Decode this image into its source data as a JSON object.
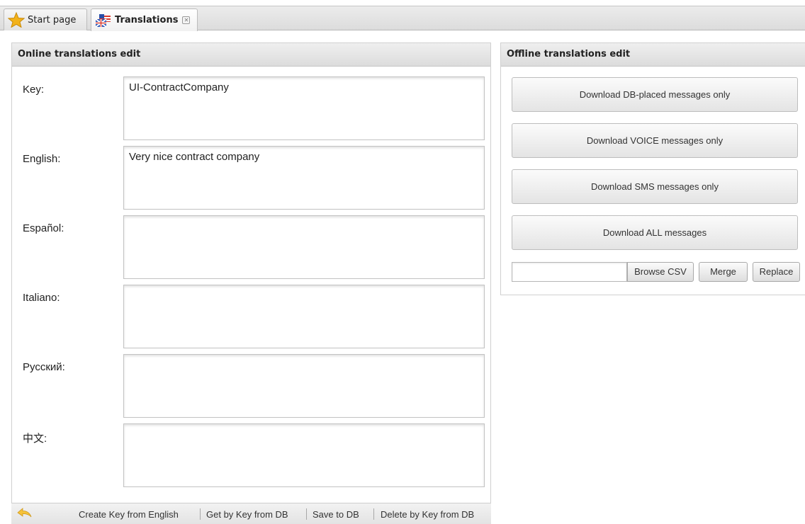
{
  "tabs": [
    {
      "label": "Start page",
      "icon": "star-icon"
    },
    {
      "label": "Translations",
      "icon": "flags-icon",
      "closable": true,
      "active": true
    }
  ],
  "online_panel": {
    "title": "Online translations edit",
    "fields": [
      {
        "label": "Key:",
        "value": "UI-ContractCompany"
      },
      {
        "label": "English:",
        "value": "Very nice contract company"
      },
      {
        "label": "Español:",
        "value": ""
      },
      {
        "label": "Italiano:",
        "value": ""
      },
      {
        "label": "Русский:",
        "value": ""
      },
      {
        "label": "中文:",
        "value": ""
      }
    ]
  },
  "toolbar": {
    "back_icon": "back-arrow-icon",
    "create_key_label": "Create Key from English",
    "get_by_key_label": "Get by Key from DB",
    "save_label": "Save to DB",
    "delete_label": "Delete by Key from DB"
  },
  "offline_panel": {
    "title": "Offline translations edit",
    "download_db_label": "Download DB-placed messages only",
    "download_voice_label": "Download VOICE messages only",
    "download_sms_label": "Download SMS messages only",
    "download_all_label": "Download ALL messages",
    "csv_file_value": "",
    "browse_label": "Browse CSV",
    "merge_label": "Merge",
    "replace_label": "Replace"
  },
  "colors": {
    "star": "#f2b21b",
    "back_arrow": "#f5c23a",
    "header_bg": "#e4e4e4"
  }
}
